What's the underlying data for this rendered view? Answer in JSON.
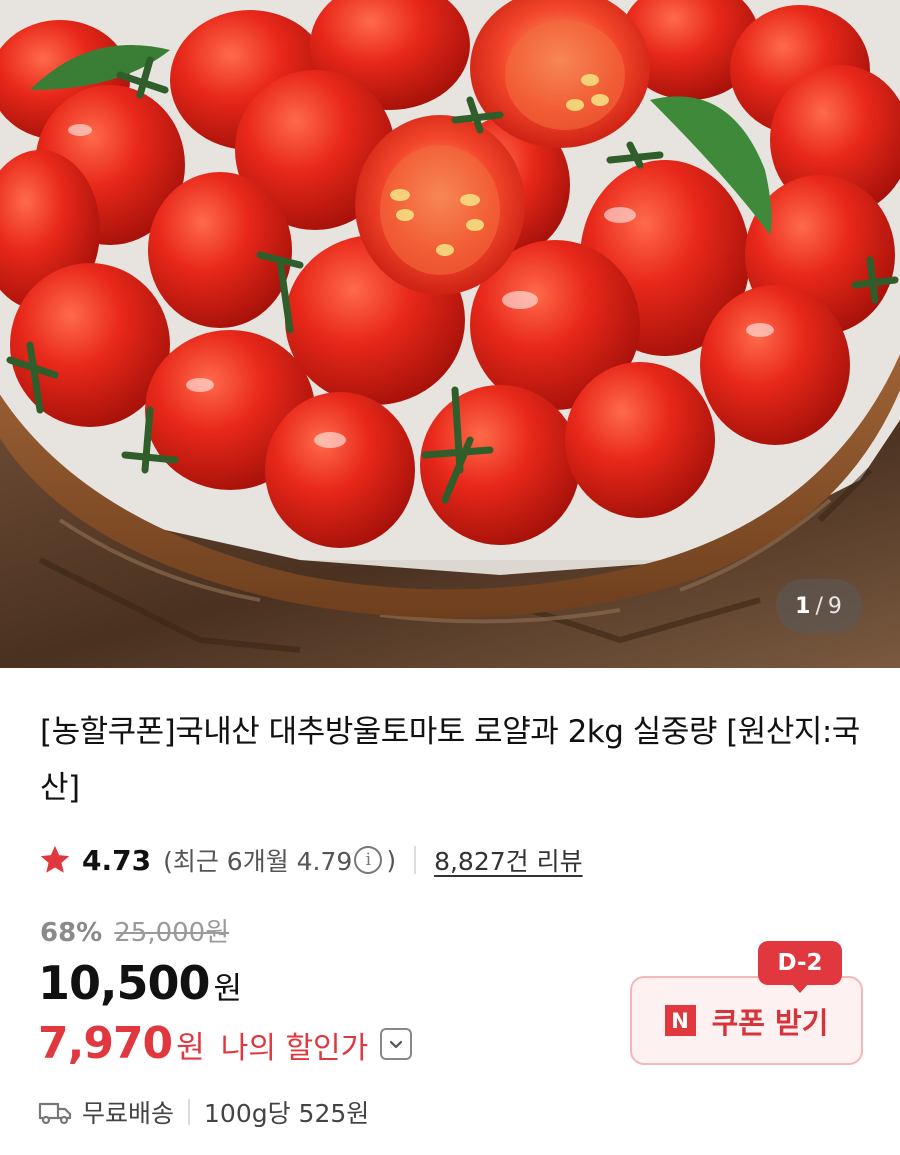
{
  "hero": {
    "image_alt": "cherry tomatoes in a wooden bowl",
    "counter_current": "1",
    "counter_sep": "/",
    "counter_total": "9"
  },
  "product": {
    "title": "[농할쿠폰]국내산 대추방울토마토 로얄과 2kg 실중량 [원산지:국산]"
  },
  "rating": {
    "icon": "star-icon",
    "value": "4.73",
    "recent_prefix": "(최근 6개월 4.79",
    "recent_suffix": ")",
    "reviews": "8,827건 리뷰"
  },
  "price": {
    "discount_rate": "68%",
    "original": "25,000원",
    "sale_number": "10,500",
    "sale_unit": "원",
    "my_number": "7,970",
    "my_unit": "원",
    "my_label": "나의 할인가"
  },
  "shipping": {
    "free": "무료배송",
    "unit_price": "100g당 525원"
  },
  "coupon": {
    "badge": "D-2",
    "brand_letter": "N",
    "label": "쿠폰 받기"
  },
  "colors": {
    "accent": "#e0383e",
    "coupon_bg": "#fdf1f1",
    "coupon_border": "#f2b8bb"
  }
}
